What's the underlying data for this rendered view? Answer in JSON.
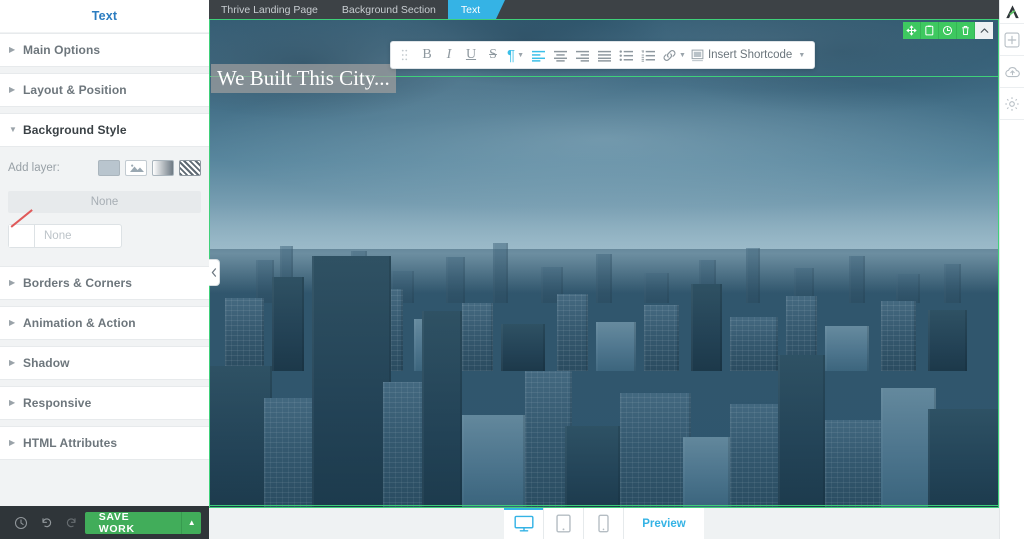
{
  "sidebar": {
    "title": "Text",
    "sections": [
      {
        "label": "Main Options",
        "open": false
      },
      {
        "label": "Layout & Position",
        "open": false
      },
      {
        "label": "Background Style",
        "open": true
      },
      {
        "label": "Borders & Corners",
        "open": false
      },
      {
        "label": "Animation & Action",
        "open": false
      },
      {
        "label": "Shadow",
        "open": false
      },
      {
        "label": "Responsive",
        "open": false
      },
      {
        "label": "HTML Attributes",
        "open": false
      }
    ],
    "background_style": {
      "add_layer_label": "Add layer:",
      "layer_buttons": [
        "solid-color-layer-icon",
        "image-layer-icon",
        "gradient-layer-icon",
        "pattern-layer-icon"
      ],
      "selected_layer_text": "None",
      "color_swatch_text": "None"
    },
    "footer": {
      "history_icon": "clock-icon",
      "undo_icon": "undo-icon",
      "redo_icon": "redo-icon",
      "save_label": "SAVE WORK",
      "save_caret": "chevron-up-icon",
      "save_color": "#41ad5a"
    }
  },
  "topbar": {
    "crumbs": [
      {
        "label": "Thrive Landing Page",
        "active": false
      },
      {
        "label": "Background Section",
        "active": false
      },
      {
        "label": "Text",
        "active": true
      }
    ],
    "active_color": "#35b3e5",
    "bg_color": "#3d4246"
  },
  "editor_toolbar": {
    "grip_icon": "drag-handle-icon",
    "items": [
      {
        "name": "bold",
        "glyph": "B",
        "active": false,
        "caret": false
      },
      {
        "name": "italic",
        "glyph": "I",
        "active": false,
        "caret": false
      },
      {
        "name": "underline",
        "glyph": "U",
        "active": false,
        "caret": false
      },
      {
        "name": "strikethrough",
        "glyph": "S",
        "active": false,
        "caret": false
      },
      {
        "name": "paragraph",
        "glyph": "¶",
        "active": true,
        "caret": true
      },
      {
        "name": "align-left",
        "glyph": "align-left-icon",
        "active": true,
        "caret": false
      },
      {
        "name": "align-center",
        "glyph": "align-center-icon",
        "active": false,
        "caret": false
      },
      {
        "name": "align-right",
        "glyph": "align-right-icon",
        "active": false,
        "caret": false
      },
      {
        "name": "align-justify",
        "glyph": "align-justify-icon",
        "active": false,
        "caret": false
      },
      {
        "name": "bullet-list",
        "glyph": "bullet-list-icon",
        "active": false,
        "caret": false
      },
      {
        "name": "numbered-list",
        "glyph": "numbered-list-icon",
        "active": false,
        "caret": false
      },
      {
        "name": "link",
        "glyph": "link-icon",
        "active": false,
        "caret": true
      }
    ],
    "shortcode_label": "Insert Shortcode",
    "shortcode_icon": "shortcode-icon",
    "active_color": "#3bbfe8"
  },
  "element_toolbar": {
    "color": "#3ec860",
    "buttons": [
      "move-icon",
      "copy-icon",
      "duplicate-icon",
      "trash-icon",
      "collapse-icon"
    ]
  },
  "canvas": {
    "headline": "We Built This City...",
    "selection_color": "#3fd07a",
    "panel_handle_icon": "chevron-left-icon",
    "scrollbar": {
      "up_icon": "chevron-up-icon",
      "down_icon": "chevron-down-icon"
    }
  },
  "right_rail": {
    "logo_icon": "thrive-logo-icon",
    "buttons": [
      "add-element-icon",
      "cloud-templates-icon",
      "settings-gear-icon"
    ]
  },
  "bottombar": {
    "devices": [
      {
        "name": "desktop",
        "icon": "desktop-icon",
        "active": true
      },
      {
        "name": "tablet",
        "icon": "tablet-icon",
        "active": false
      },
      {
        "name": "mobile",
        "icon": "mobile-icon",
        "active": false
      }
    ],
    "preview_label": "Preview",
    "accent_color": "#35b3e5"
  }
}
